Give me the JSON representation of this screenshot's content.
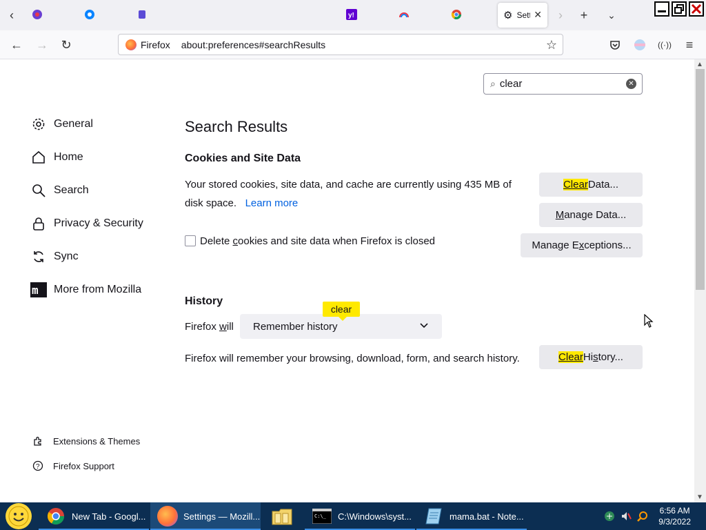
{
  "tabs": {
    "active_label": "Setti",
    "icons": [
      "tab-icon-1",
      "tab-icon-2",
      "tab-icon-3",
      "yahoo-icon",
      "tab-icon-5",
      "chrome-icon"
    ]
  },
  "urlbar": {
    "identity": "Firefox",
    "url": "about:preferences#searchResults"
  },
  "search": {
    "value": "clear"
  },
  "sidebar": {
    "items": [
      {
        "label": "General"
      },
      {
        "label": "Home"
      },
      {
        "label": "Search"
      },
      {
        "label": "Privacy & Security"
      },
      {
        "label": "Sync"
      },
      {
        "label": "More from Mozilla"
      }
    ],
    "footer": [
      {
        "label": "Extensions & Themes"
      },
      {
        "label": "Firefox Support"
      }
    ]
  },
  "main": {
    "title": "Search Results",
    "cookies": {
      "heading": "Cookies and Site Data",
      "desc_line1": "Your stored cookies, site data, and cache are currently using 435 MB of",
      "desc_line2": "disk space.",
      "learn_more": "Learn more",
      "clear_data_hl": "Clear",
      "clear_data_rest": " Data...",
      "manage_data_u": "M",
      "manage_data_rest": "anage Data...",
      "manage_exc_pre": "Manage E",
      "manage_exc_u": "x",
      "manage_exc_rest": "ceptions...",
      "checkbox_pre": "Delete ",
      "checkbox_u": "c",
      "checkbox_rest": "ookies and site data when Firefox is closed"
    },
    "history": {
      "heading": "History",
      "will_pre": "Firefox ",
      "will_u": "w",
      "will_rest": "ill",
      "select_value": "Remember history",
      "tooltip": "clear",
      "desc": "Firefox will remember your browsing, download, form, and search history.",
      "clear_hl": "Clear",
      "clear_pre": " Hi",
      "clear_u": "s",
      "clear_rest": "tory..."
    }
  },
  "taskbar": {
    "items": [
      {
        "label": "New Tab - Googl..."
      },
      {
        "label": "Settings — Mozill..."
      },
      {
        "label": ""
      },
      {
        "label": "C:\\Windows\\syst..."
      },
      {
        "label": "mama.bat - Note..."
      }
    ],
    "time": "6:56 AM",
    "date": "9/3/2022"
  },
  "colors": {
    "highlight": "#ffe900",
    "link": "#0061e0",
    "taskbar": "#0c2e52"
  }
}
